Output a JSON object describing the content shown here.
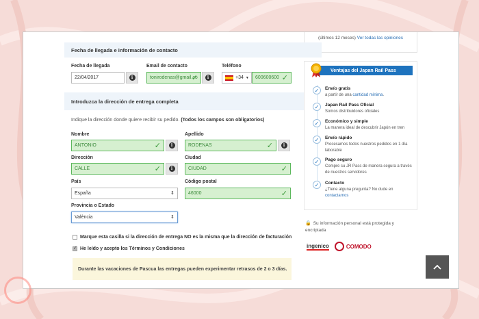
{
  "top_card": {
    "line1": "(últimos 12 meses)",
    "link": "Ver todas las opiniones"
  },
  "contact_section": {
    "title": "Fecha de llegada e información de contacto",
    "arrival_label": "Fecha de llegada",
    "arrival_value": "22/04/2017",
    "email_label": "Email de contacto",
    "email_value": "tonirodenas@gmail.co",
    "phone_label": "Teléfono",
    "phone_code": "+34",
    "phone_value": "600600600"
  },
  "address_section": {
    "title": "Introduzca la dirección de entrega completa",
    "hint": "Indique la dirección donde quiere recibir su pedido.",
    "hint_bold": "(Todos los campos son obligatorios)",
    "name_label": "Nombre",
    "name_value": "ANTONIO",
    "surname_label": "Apellido",
    "surname_value": "RODENAS",
    "address_label": "Dirección",
    "address_value": "CALLE",
    "city_label": "Ciudad",
    "city_value": "CIUDAD",
    "country_label": "País",
    "country_value": "España",
    "zip_label": "Código postal",
    "zip_value": "46000",
    "province_label": "Provincia o Estado",
    "province_value": "València"
  },
  "checkboxes": {
    "billing_label": "Marque esta casilla si la dirección de entrega NO es la misma que la dirección de facturación",
    "billing_checked": false,
    "terms_label": "He leído y acepto los Términos y Condiciones",
    "terms_checked": true
  },
  "notice": "Durante las vacaciones de Pascua las entregas pueden experimentar retrasos de 2 o 3 días.",
  "benefits": {
    "title": "Ventajas del Japan Rail Pass",
    "items": [
      {
        "title": "Envío gratis",
        "desc": "a partir de una",
        "link": "cantidad mínima",
        "tail": "."
      },
      {
        "title": "Japan Rail Pass Oficial",
        "desc": "Somos distribuidores oficiales",
        "link": "",
        "tail": ""
      },
      {
        "title": "Económico y simple",
        "desc": "La manera ideal de descubrir Japón en tren",
        "link": "",
        "tail": ""
      },
      {
        "title": "Envío rápido",
        "desc": "Procesamos todos nuestros pedidos en 1 día laborable",
        "link": "",
        "tail": ""
      },
      {
        "title": "Pago seguro",
        "desc": "Compre su JR Pass de manera segura a través de nuestros servidores",
        "link": "",
        "tail": ""
      },
      {
        "title": "Contacto",
        "desc": "¿Tiene alguna pregunta? No dude en",
        "link": "contactarnos",
        "tail": ""
      }
    ]
  },
  "secure_text": "Su información personal está protegida y encriptada",
  "logos": {
    "ingenico": "ingenico",
    "comodo": "COMODO"
  },
  "colors": {
    "accent": "#1e73be",
    "valid_bg": "#d6f0d0",
    "valid_border": "#5cb85c",
    "page_bg": "#f6dcd8"
  }
}
